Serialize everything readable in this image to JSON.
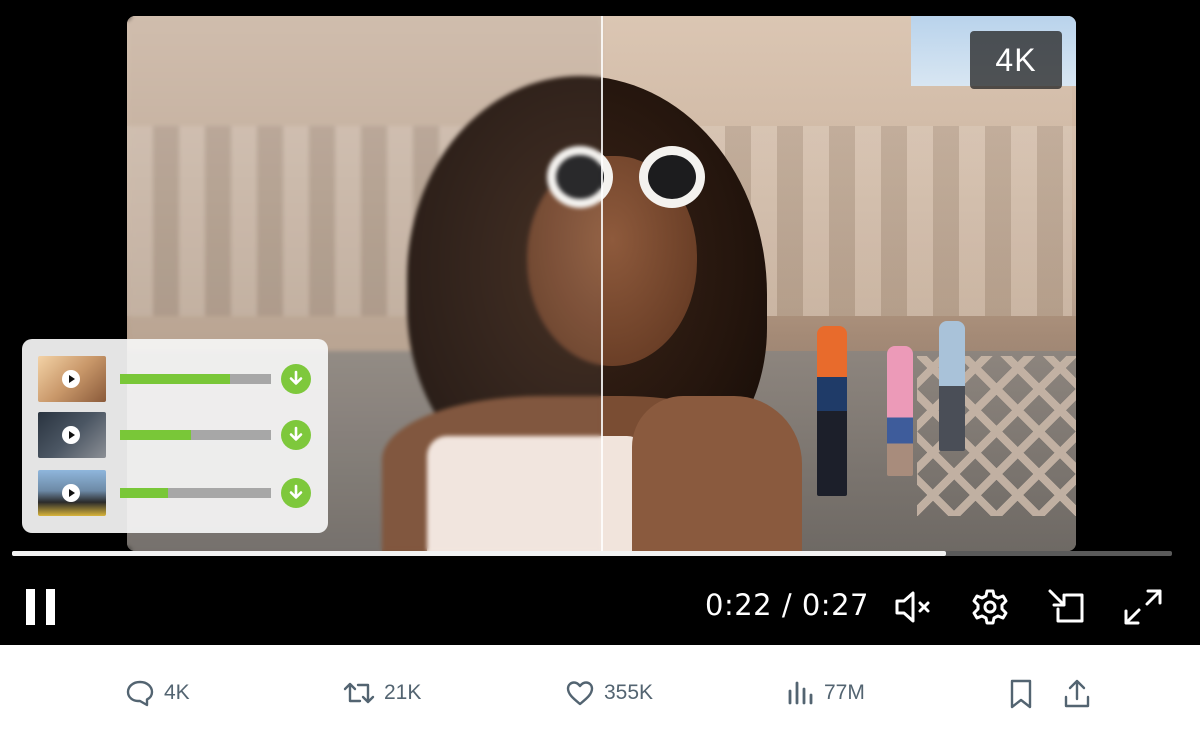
{
  "player": {
    "quality_badge": "4K",
    "time": {
      "current": "0:22",
      "separator": " / ",
      "total": "0:27"
    },
    "progress_fraction": 0.805,
    "controls": {
      "play_state_icon": "pause-icon",
      "mute_icon": "volume-muted-icon",
      "settings_icon": "gear-icon",
      "pip_icon": "picture-in-picture-icon",
      "fullscreen_icon": "fullscreen-icon"
    }
  },
  "downloads": {
    "items": [
      {
        "progress": 0.73,
        "icon": "download-icon"
      },
      {
        "progress": 0.47,
        "icon": "download-icon"
      },
      {
        "progress": 0.32,
        "icon": "download-icon"
      }
    ],
    "colors": {
      "progress_fill": "#79c738",
      "button": "#7ec83c",
      "track": "#a7a7a7"
    }
  },
  "engagement": {
    "replies": "4K",
    "reposts": "21K",
    "likes": "355K",
    "views": "77M"
  },
  "colors": {
    "icon_gray": "#536471",
    "player_bg": "#000000"
  }
}
